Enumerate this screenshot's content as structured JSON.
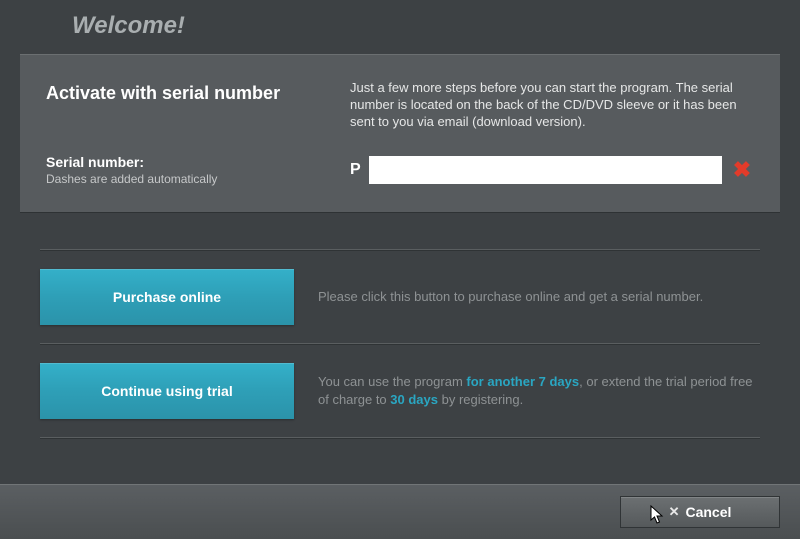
{
  "title": "Welcome!",
  "activate": {
    "heading": "Activate with serial number",
    "instructions": "Just a few more steps before you can start the program. The serial number is located on the back of the CD/DVD sleeve or it has been sent to you via email (download version).",
    "label": "Serial number:",
    "sublabel": "Dashes are added automatically",
    "prefix": "P",
    "value": "",
    "validity_icon": "✖"
  },
  "purchase": {
    "button": "Purchase online",
    "text": "Please click this button to purchase online and get a serial number."
  },
  "trial": {
    "button": "Continue using trial",
    "text_a": "You can use the program ",
    "hl_a": "for another 7 days",
    "text_b": ", or extend the trial period free of charge to ",
    "hl_b": "30 days",
    "text_c": " by registering."
  },
  "footer": {
    "cancel_icon": "✕",
    "cancel_label": "Cancel"
  }
}
